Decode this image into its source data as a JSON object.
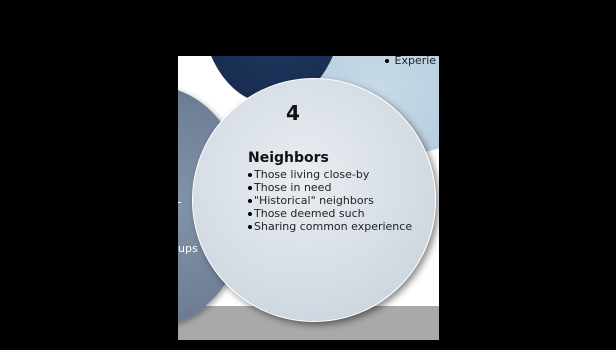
{
  "slide": {
    "top_bullet_text": "Experie",
    "left_fragment_text": "ups",
    "section_number": "4",
    "heading": "Neighbors",
    "bullets": [
      "Those living close-by",
      "Those in need",
      "\"Historical\" neighbors",
      "Those deemed such",
      "Sharing common experience"
    ]
  },
  "colors": {
    "background": "#000000",
    "main_circle": "#d6dde5",
    "dark_circle": "#16294a",
    "light_blue_circle": "#b0c9dc",
    "left_circle": "#6f8097",
    "bottom_band": "#a9a9a9"
  }
}
